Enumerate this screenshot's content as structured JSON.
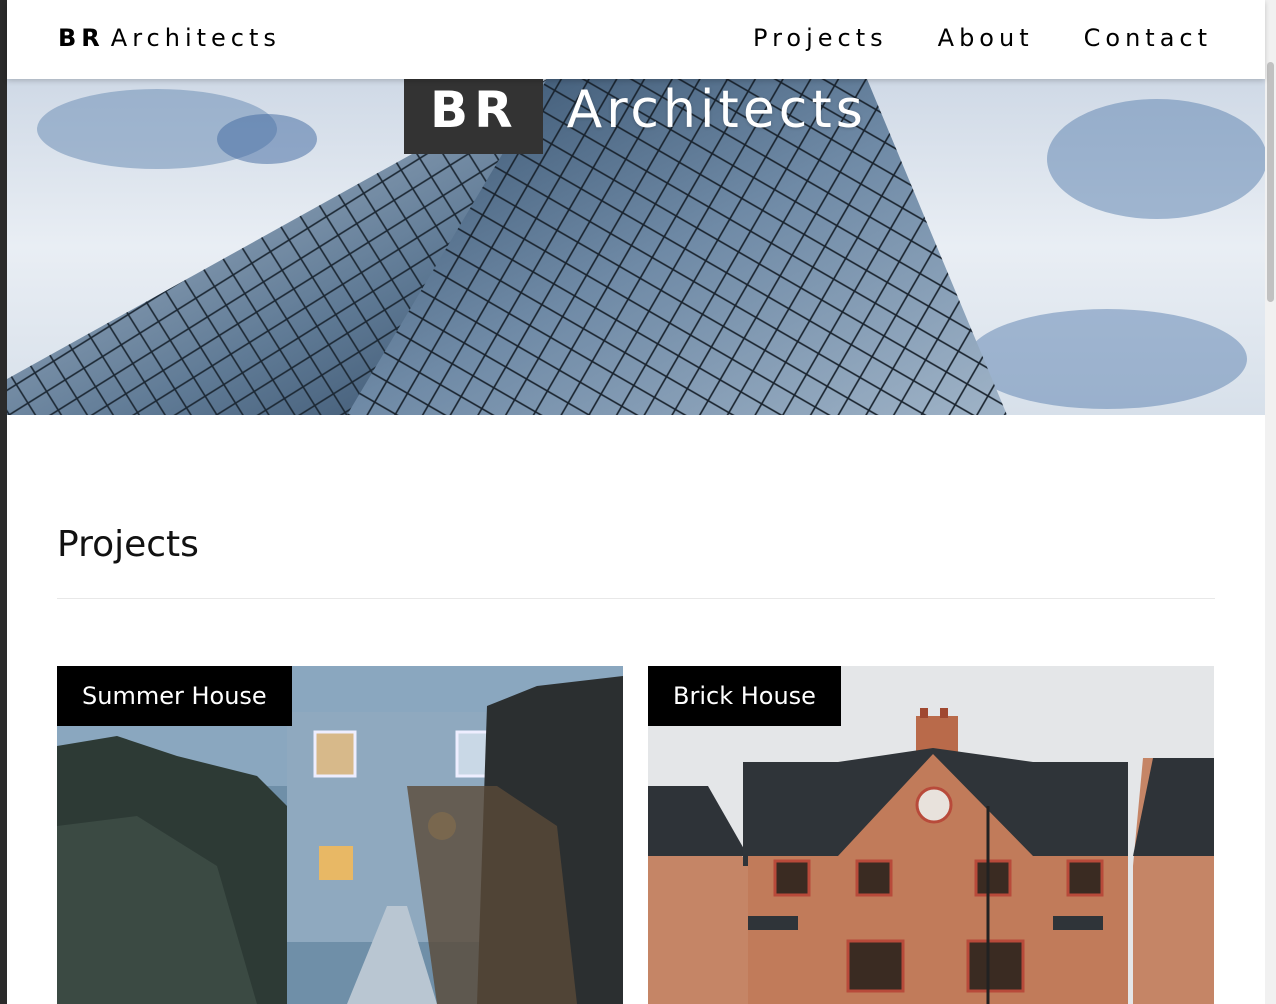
{
  "navbar": {
    "brand_bold": "BR",
    "brand_rest": "Architects",
    "links": [
      {
        "label": "Projects"
      },
      {
        "label": "About"
      },
      {
        "label": "Contact"
      }
    ]
  },
  "hero": {
    "title_bold": "BR",
    "title_rest": "Architects",
    "image": "glass-building-photo"
  },
  "projects": {
    "heading": "Projects",
    "items": [
      {
        "label": "Summer House",
        "image": "summer-house-photo"
      },
      {
        "label": "Brick House",
        "image": "brick-house-photo"
      }
    ]
  },
  "colors": {
    "label_bg": "#000000",
    "hero_title_bg": "#333333",
    "text": "#000000"
  }
}
